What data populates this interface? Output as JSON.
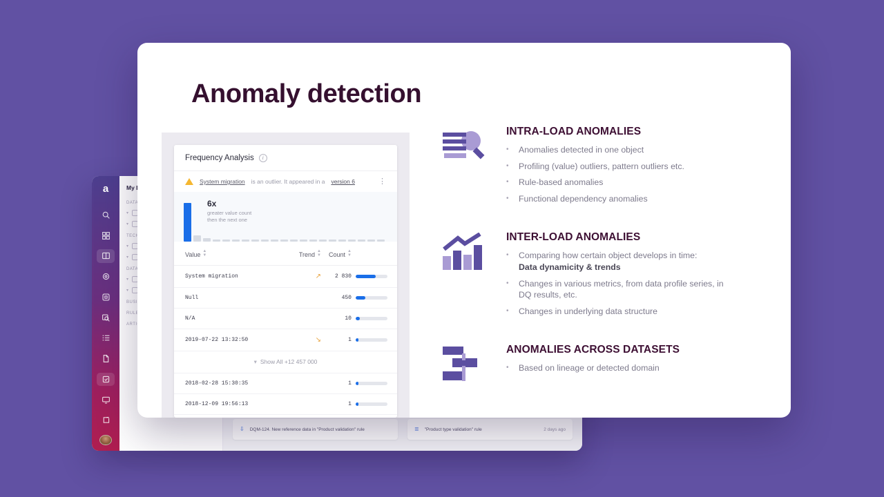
{
  "background_color": "#6151a3",
  "slide": {
    "title": "Anomaly detection",
    "title_color": "#35102f"
  },
  "product_shot": {
    "card_title": "Frequency Analysis",
    "info_icon": "info-icon",
    "alert": {
      "icon": "warning-triangle-icon",
      "subject": "System migration",
      "middle": " is an outlier. It appeared in a ",
      "version": "version 6",
      "menu_icon": "kebab-menu-icon"
    },
    "callout": {
      "value": "6x",
      "line1": "greater value count",
      "line2": "then the next one"
    },
    "table": {
      "columns": [
        "Value",
        "Trend",
        "Count"
      ],
      "rows": [
        {
          "value": "System migration",
          "trend": "up",
          "count": "2 830",
          "bar_pct": 62
        },
        {
          "value": "Null",
          "trend": "",
          "count": "450",
          "bar_pct": 30
        },
        {
          "value": "N/A",
          "trend": "",
          "count": "10",
          "bar_pct": 12
        },
        {
          "value": "2019-07-22 13:32:50",
          "trend": "down",
          "count": "1",
          "bar_pct": 9
        }
      ],
      "show_all_label": "Show All +12 457 000",
      "rows_after": [
        {
          "value": "2018-02-28 15:30:35",
          "trend": "",
          "count": "1",
          "bar_pct": 9
        },
        {
          "value": "2018-12-09 19:56:13",
          "trend": "",
          "count": "1",
          "bar_pct": 9
        }
      ]
    }
  },
  "sections": [
    {
      "icon": "magnifier-over-bars-icon",
      "heading": "INTRA-LOAD ANOMALIES",
      "bullets": [
        {
          "text": "Anomalies detected in one object"
        },
        {
          "text": "Profiling (value) outliers, pattern outliers etc."
        },
        {
          "text": "Rule-based anomalies"
        },
        {
          "text": "Functional dependency anomalies"
        }
      ]
    },
    {
      "icon": "trend-bar-chart-icon",
      "heading": "INTER-LOAD ANOMALIES",
      "bullets": [
        {
          "text": "Comparing how certain object develops in time:",
          "strong": "Data dynamicity & trends"
        },
        {
          "text": "Changes in various metrics, from data profile series, in DQ results, etc."
        },
        {
          "text": "Changes in underlying data structure"
        }
      ]
    },
    {
      "icon": "lineage-blocks-icon",
      "heading": "ANOMALIES ACROSS DATASETS",
      "bullets": [
        {
          "text": "Based on lineage or detected domain"
        }
      ]
    }
  ],
  "app_window": {
    "logo": "a",
    "sidebar_icons": [
      "search-icon",
      "dashboard-icon",
      "catalog-icon",
      "settings-icon",
      "database-icon",
      "monitoring-icon",
      "list-icon",
      "document-icon",
      "tasks-icon"
    ],
    "bottom_icons": [
      "display-icon",
      "external-link-icon"
    ],
    "avatar": "user-avatar",
    "nav": {
      "title": "My Da",
      "items": [
        {
          "type": "group",
          "label": "DATA C"
        },
        {
          "type": "row"
        },
        {
          "type": "row"
        },
        {
          "type": "group",
          "label": "TECHNO"
        },
        {
          "type": "row"
        },
        {
          "type": "row"
        },
        {
          "type": "group",
          "label": "DATA S"
        },
        {
          "type": "row"
        },
        {
          "type": "row"
        },
        {
          "type": "group",
          "label": "BUSINE"
        },
        {
          "type": "group",
          "label": "RULES"
        },
        {
          "type": "group",
          "label": "ARTICLE"
        }
      ]
    },
    "cards": [
      {
        "icon": "merge-icon",
        "text": "DQM-124. New reference data in \"Product validation\" rule",
        "time": ""
      },
      {
        "icon": "rule-list-icon",
        "text": "\"Product type validation\" rule",
        "time": "2 days ago"
      }
    ]
  }
}
